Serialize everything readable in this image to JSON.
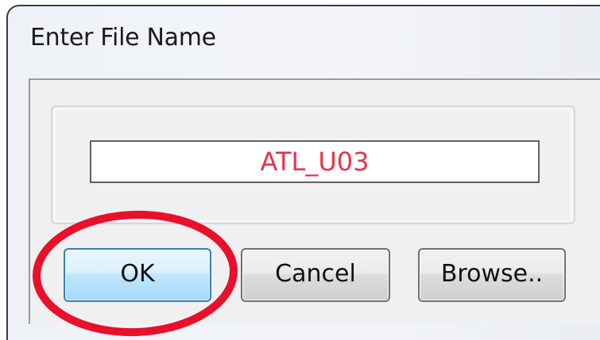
{
  "dialog": {
    "title": "Enter File Name",
    "filename_value": "ATL_U03",
    "buttons": {
      "ok": "OK",
      "cancel": "Cancel",
      "browse": "Browse.."
    }
  },
  "colors": {
    "filename_text": "#e8334c",
    "annotation": "#e8102a",
    "ok_border": "#3c7fb1"
  },
  "annotation": {
    "shape": "ellipse",
    "target": "ok-button"
  }
}
